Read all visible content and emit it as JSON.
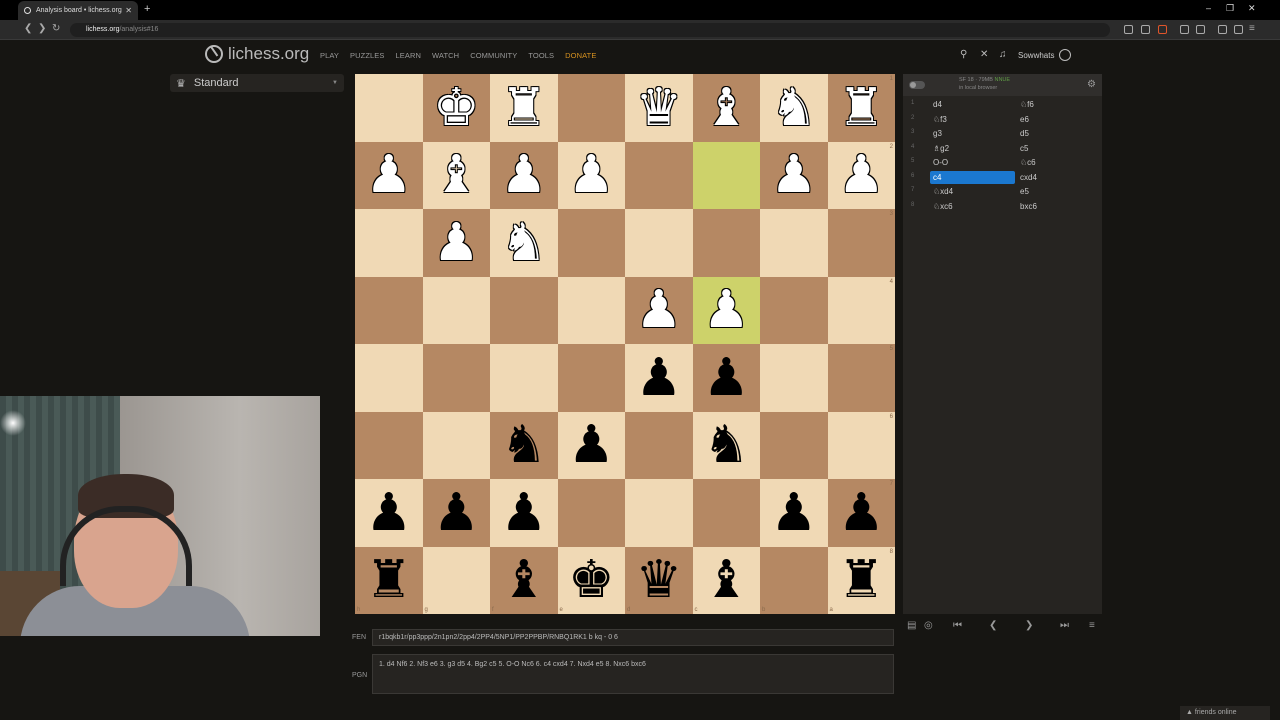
{
  "browser": {
    "tab_title": "Analysis board • lichess.org",
    "new_tab": "+",
    "url_host": "lichess.org",
    "url_path": "/analysis#16",
    "win_min": "–",
    "win_max": "❐",
    "win_close": "✕"
  },
  "header": {
    "logo_text": "lichess.org",
    "nav": [
      "PLAY",
      "PUZZLES",
      "LEARN",
      "WATCH",
      "COMMUNITY",
      "TOOLS",
      "DONATE"
    ],
    "username": "Sowwhats"
  },
  "variant": {
    "label": "Standard"
  },
  "board": {
    "pieces": [
      [
        "",
        "K",
        "R",
        "",
        "Q",
        "B",
        "N",
        "R"
      ],
      [
        "P",
        "B",
        "P",
        "P",
        "",
        "",
        "P",
        "P"
      ],
      [
        "",
        "P",
        "N",
        "",
        "",
        "",
        "",
        ""
      ],
      [
        "",
        "",
        "",
        "",
        "P",
        "P",
        "",
        ""
      ],
      [
        "",
        "",
        "",
        "",
        "p",
        "p",
        "",
        ""
      ],
      [
        "",
        "",
        "n",
        "p",
        "",
        "n",
        "",
        ""
      ],
      [
        "p",
        "p",
        "p",
        "",
        "",
        "",
        "p",
        "p"
      ],
      [
        "r",
        "",
        "b",
        "k",
        "q",
        "b",
        "",
        "r"
      ]
    ],
    "highlights": [
      [
        1,
        5
      ],
      [
        3,
        5
      ]
    ],
    "files": [
      "h",
      "g",
      "f",
      "e",
      "d",
      "c",
      "b",
      "a"
    ],
    "ranks": [
      "1",
      "2",
      "3",
      "4",
      "5",
      "6",
      "7",
      "8"
    ]
  },
  "ceval": {
    "engine": "SF 18 · 79MB",
    "nnue": "NNUE",
    "location": "in local browser"
  },
  "moves": [
    {
      "n": "1",
      "w": "d4",
      "b": "♘f6"
    },
    {
      "n": "2",
      "w": "♘f3",
      "b": "e6"
    },
    {
      "n": "3",
      "w": "g3",
      "b": "d5"
    },
    {
      "n": "4",
      "w": "♗g2",
      "b": "c5"
    },
    {
      "n": "5",
      "w": "O-O",
      "b": "♘c6"
    },
    {
      "n": "6",
      "w": "c4",
      "b": "cxd4"
    },
    {
      "n": "7",
      "w": "♘xd4",
      "b": "e5"
    },
    {
      "n": "8",
      "w": "♘xc6",
      "b": "bxc6"
    }
  ],
  "active_move": {
    "row": 5,
    "side": "w"
  },
  "controls": [
    "▤",
    "◎",
    "⏮",
    "❮",
    "❯",
    "⏭",
    "≡"
  ],
  "fen": {
    "label": "FEN",
    "value": "r1bqkb1r/pp3ppp/2n1pn2/2pp4/2PP4/5NP1/PP2PPBP/RNBQ1RK1 b kq - 0 6"
  },
  "pgn": {
    "label": "PGN",
    "value": "1. d4 Nf6 2. Nf3 e6 3. g3 d5 4. Bg2 c5 5. O-O Nc6 6. c4 cxd4 7. Nxd4 e5 8. Nxc6 bxc6"
  },
  "friends": "friends online"
}
